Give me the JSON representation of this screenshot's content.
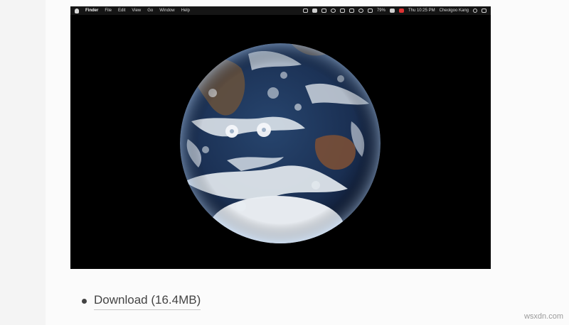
{
  "menubar": {
    "app_name": "Finder",
    "menus": [
      "File",
      "Edit",
      "View",
      "Go",
      "Window",
      "Help"
    ],
    "battery": "79%",
    "clock": "Thu 10:25 PM",
    "user": "Cheolgoo Kang"
  },
  "content": {
    "download_label": "Download (16.4MB)"
  },
  "watermark": "wsxdn.com",
  "colors": {
    "screen_bg": "#000000",
    "ocean": "#1f3558",
    "cloud": "#e8edf2",
    "land": "#6b4a36"
  }
}
